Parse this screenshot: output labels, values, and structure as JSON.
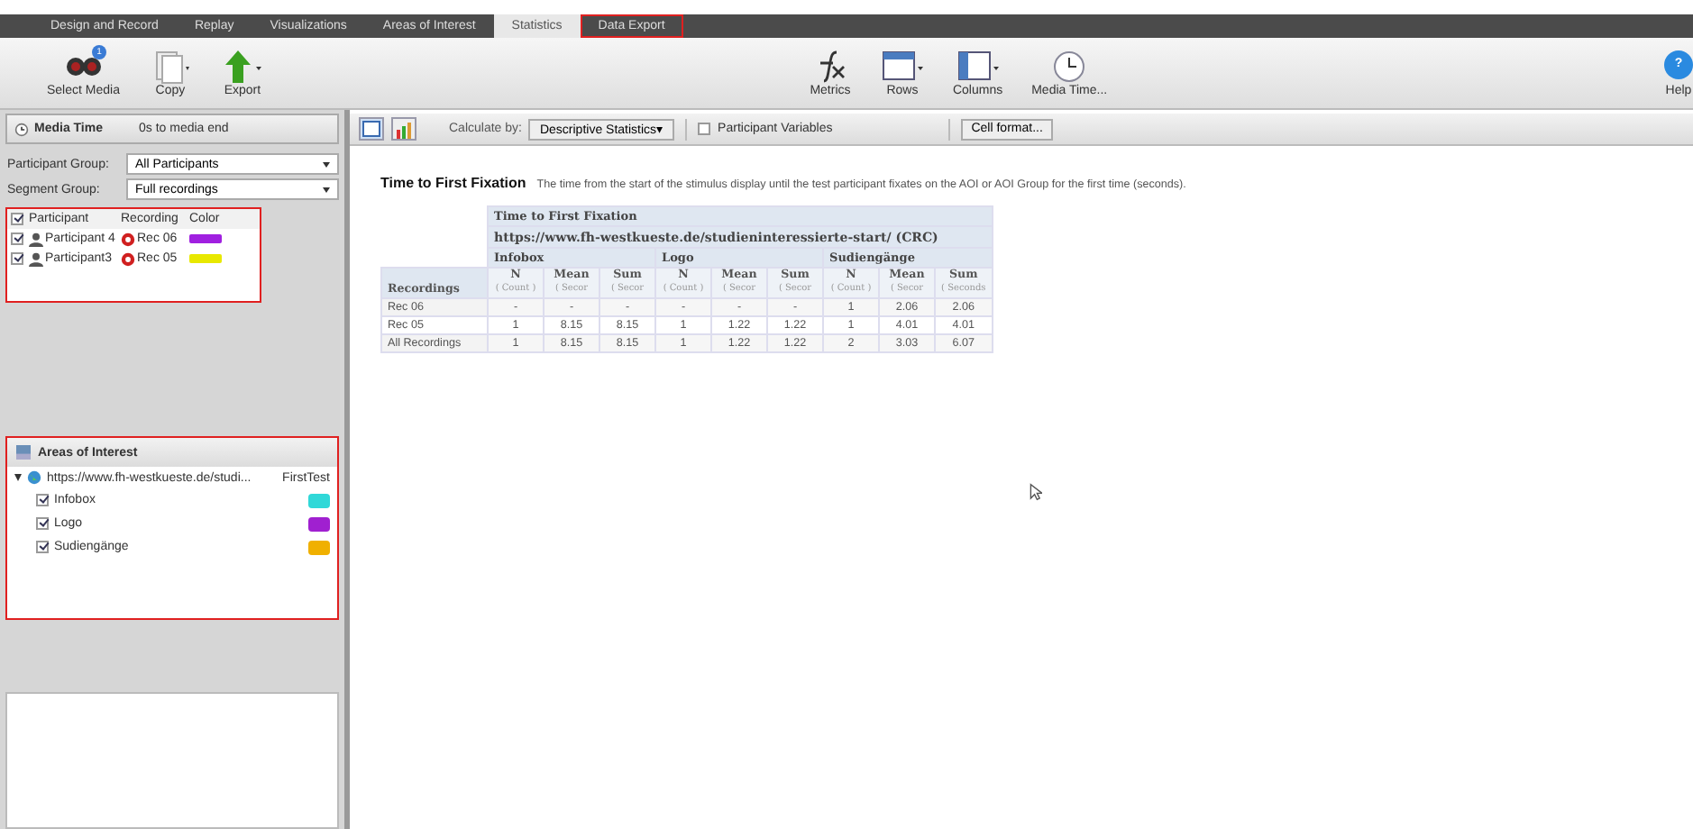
{
  "tabs": [
    {
      "label": "Design and Record",
      "selected": false,
      "highlighted": false
    },
    {
      "label": "Replay",
      "selected": false,
      "highlighted": false
    },
    {
      "label": "Visualizations",
      "selected": false,
      "highlighted": false
    },
    {
      "label": "Areas of Interest",
      "selected": false,
      "highlighted": false
    },
    {
      "label": "Statistics",
      "selected": true,
      "highlighted": false
    },
    {
      "label": "Data Export",
      "selected": false,
      "highlighted": true
    }
  ],
  "toolbar_left": [
    {
      "label": "Select Media",
      "kind": "binoculars",
      "badge": "1"
    },
    {
      "label": "Copy",
      "kind": "copy"
    },
    {
      "label": "Export",
      "kind": "export"
    }
  ],
  "toolbar_right": [
    {
      "label": "Metrics",
      "kind": "function"
    },
    {
      "label": "Rows",
      "kind": "rows"
    },
    {
      "label": "Columns",
      "kind": "columns"
    },
    {
      "label": "Media Time...",
      "kind": "clock"
    }
  ],
  "help": {
    "label": "Help",
    "glyph": "?"
  },
  "media_time": {
    "title": "Media Time",
    "value": "0s to media end"
  },
  "participant_group": {
    "label": "Participant Group:",
    "value": "All Participants"
  },
  "segment_group": {
    "label": "Segment Group:",
    "value": "Full recordings"
  },
  "participants": {
    "highlighted": true,
    "all_checked": true,
    "columns": [
      "Participant",
      "Recording",
      "Color"
    ],
    "rows": [
      {
        "name": "Participant 4",
        "recording": "Rec 06",
        "color": "#a020e0",
        "checked": true
      },
      {
        "name": "Participant3",
        "recording": "Rec 05",
        "color": "#e8e800",
        "checked": true
      }
    ]
  },
  "aoi_panel": {
    "title": "Areas of Interest",
    "highlighted": true,
    "media": {
      "name": "https://www.fh-westkueste.de/studi...",
      "test": "FirstTest",
      "expanded": true,
      "children": [
        {
          "name": "Infobox",
          "checked": true,
          "color": "#30d8d8"
        },
        {
          "name": "Logo",
          "checked": true,
          "color": "#a020d0"
        },
        {
          "name": "Sudiengänge",
          "checked": true,
          "color": "#f0b000"
        }
      ]
    }
  },
  "subtoolbar": {
    "calculate_label": "Calculate by:",
    "calculate_value": "Descriptive Statistics▾",
    "participant_variables": {
      "label": "Participant Variables",
      "checked": false
    },
    "cell_format": "Cell format..."
  },
  "metric": {
    "title": "Time to First Fixation",
    "description": "The time from the start of the stimulus display until the test participant fixates on the AOI or AOI Group for the first time (seconds)."
  },
  "table": {
    "title": "Time to First Fixation",
    "media": "https://www.fh-westkueste.de/studieninteressierte-start/ (CRC)",
    "groups": [
      "Infobox",
      "Logo",
      "Sudiengänge"
    ],
    "columns": [
      {
        "name": "N",
        "unit": "( Count )"
      },
      {
        "name": "Mean",
        "unit": "( Secor"
      },
      {
        "name": "Sum",
        "unit": "( Secor"
      },
      {
        "name": "N",
        "unit": "( Count )"
      },
      {
        "name": "Mean",
        "unit": "( Secor"
      },
      {
        "name": "Sum",
        "unit": "( Secor"
      },
      {
        "name": "N",
        "unit": "( Count )"
      },
      {
        "name": "Mean",
        "unit": "( Secor"
      },
      {
        "name": "Sum",
        "unit": "( Seconds"
      }
    ],
    "row_header": "Recordings",
    "rows": [
      {
        "label": "Rec 06",
        "cells": [
          "-",
          "-",
          "-",
          "-",
          "-",
          "-",
          "1",
          "2.06",
          "2.06"
        ]
      },
      {
        "label": "Rec 05",
        "cells": [
          "1",
          "8.15",
          "8.15",
          "1",
          "1.22",
          "1.22",
          "1",
          "4.01",
          "4.01"
        ]
      },
      {
        "label": "All Recordings",
        "cells": [
          "1",
          "8.15",
          "8.15",
          "1",
          "1.22",
          "1.22",
          "2",
          "3.03",
          "6.07"
        ]
      }
    ]
  }
}
